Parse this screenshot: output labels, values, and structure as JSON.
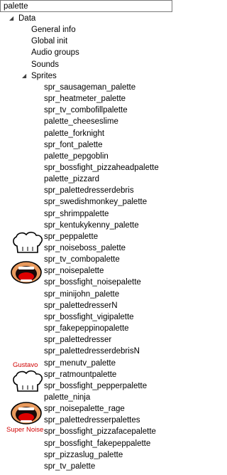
{
  "search": {
    "value": "palette"
  },
  "tree": {
    "root": {
      "label": "Data",
      "expanded": true
    },
    "children": [
      "General info",
      "Global init",
      "Audio groups",
      "Sounds"
    ],
    "sprites": {
      "label": "Sprites",
      "expanded": true,
      "items": [
        "spr_sausageman_palette",
        "spr_heatmeter_palette",
        "spr_tv_combofillpalette",
        "palette_cheeseslime",
        "palette_forknight",
        "spr_font_palette",
        "palette_pepgoblin",
        "spr_bossfight_pizzaheadpalette",
        "palette_pizzard",
        "spr_palettedresserdebris",
        "spr_swedishmonkey_palette",
        "spr_shrimppalette",
        "spr_kentukykenny_palette",
        "spr_peppalette",
        "spr_noiseboss_palette",
        "spr_tv_combopalette",
        "spr_noisepalette",
        "spr_bossfight_noisepalette",
        "spr_minijohn_palette",
        "spr_palettedresserN",
        "spr_bossfight_vigipalette",
        "spr_fakepeppinopalette",
        "spr_palettedresser",
        "spr_palettedresserdebrisN",
        "spr_menutv_palette",
        "spr_ratmountpalette",
        "spr_bossfight_pepperpalette",
        "palette_ninja",
        "spr_noisepalette_rage",
        "spr_palettedresserpalettes",
        "spr_bossfight_pizzafacepalette",
        "spr_bossfight_fakepeppalette",
        "spr_pizzaslug_palette",
        "spr_tv_palette"
      ]
    }
  },
  "thumb_labels": {
    "gustavo": "Gustavo",
    "super_noise": "Super Noise"
  }
}
